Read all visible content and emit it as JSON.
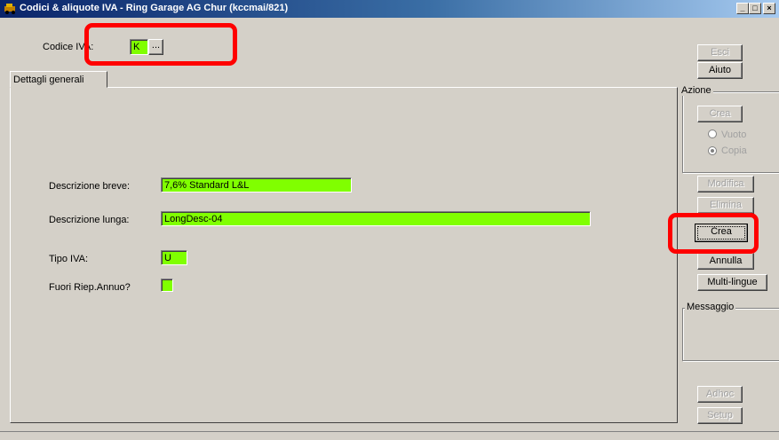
{
  "window": {
    "title": "Codici & aliquote IVA - Ring Garage AG Chur (kccmai/821)",
    "controls": {
      "minimize": "_",
      "maximize": "□",
      "close": "×"
    }
  },
  "header": {
    "codice_label": "Codice IVA:",
    "codice_value": "K",
    "browse_label": "..."
  },
  "tabs": [
    {
      "label": "Dettagli generali"
    }
  ],
  "form": {
    "desc_breve_label": "Descrizione breve:",
    "desc_breve_value": "7,6% Standard L&L",
    "desc_lunga_label": "Descrizione lunga:",
    "desc_lunga_value": "LongDesc-04",
    "tipo_iva_label": "Tipo IVA:",
    "tipo_iva_value": "U",
    "fuori_label": "Fuori Riep.Annuo?",
    "fuori_value": ""
  },
  "sidebar": {
    "esci": "Esci",
    "aiuto": "Aiuto",
    "azione_title": "Azione",
    "crea_top": "Crea",
    "vuoto": "Vuoto",
    "copia": "Copia",
    "modifica": "Modifica",
    "elimina": "Elimina",
    "crea_active": "Crea",
    "annulla": "Annulla",
    "multilingue": "Multi-lingue",
    "messaggio_title": "Messaggio",
    "adhoc": "Adhoc",
    "setup": "Setup"
  },
  "colors": {
    "field": "#80ff00",
    "highlight": "#ff0000",
    "titlebar": "#0a246a"
  }
}
